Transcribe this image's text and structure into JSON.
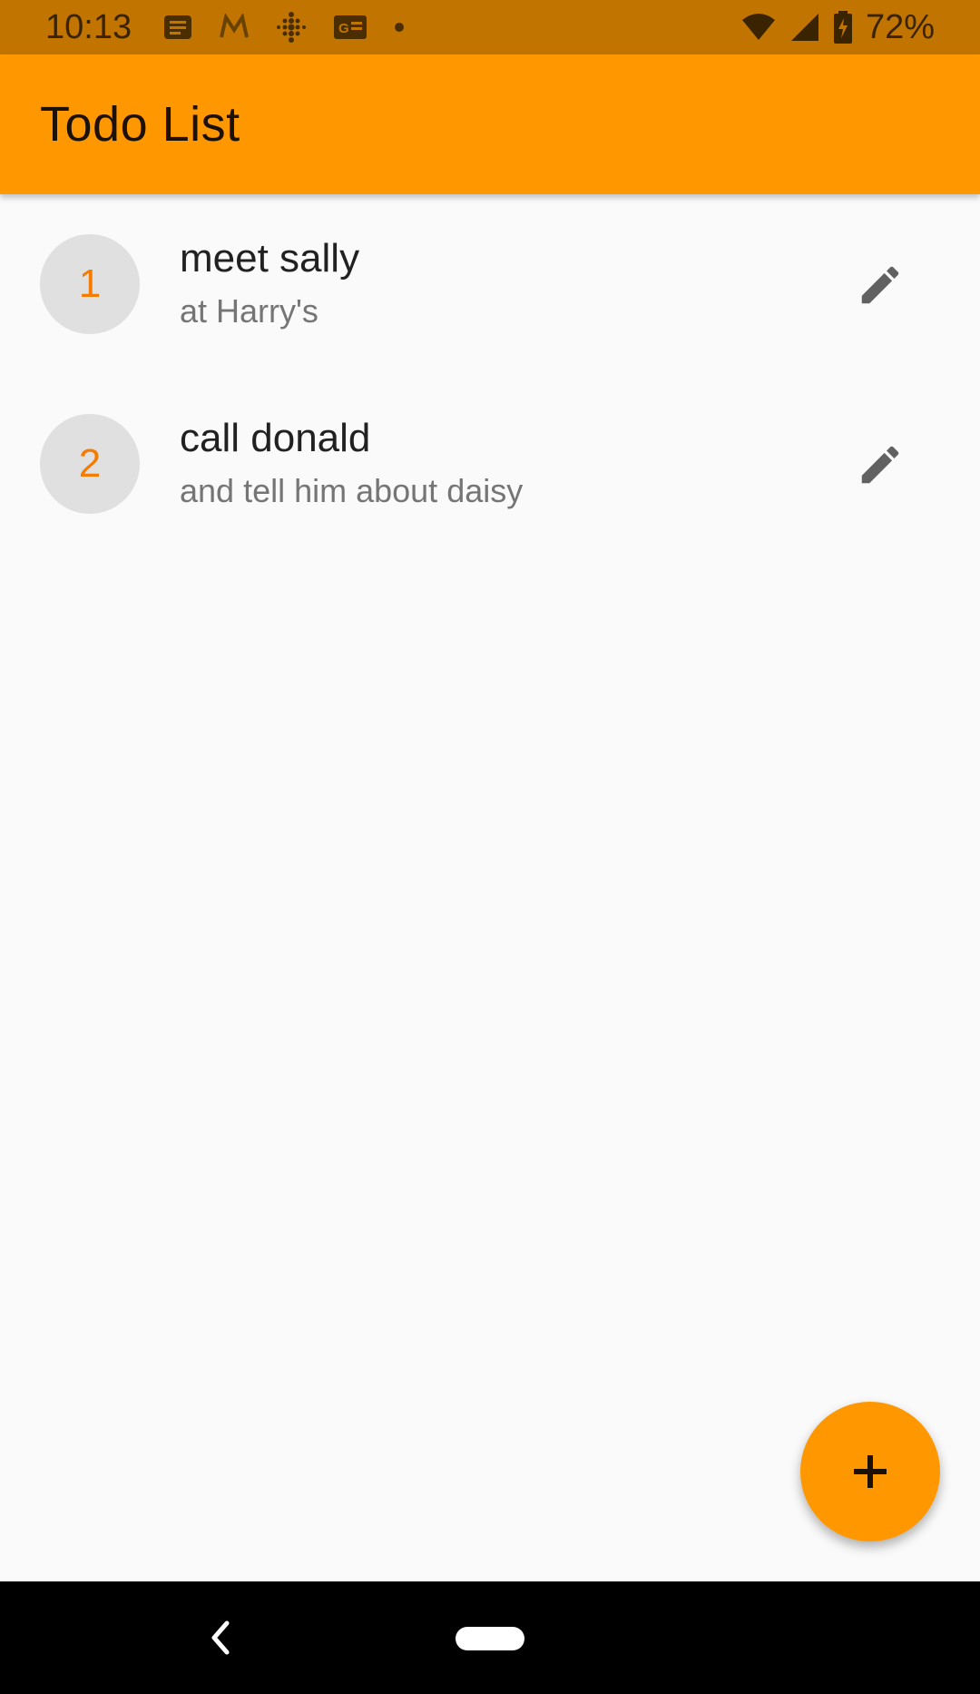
{
  "status_bar": {
    "time": "10:13",
    "battery_percent": "72%",
    "left_icons": [
      "notes-icon",
      "gmail-icon",
      "fitbit-icon",
      "news-icon",
      "dot-icon"
    ],
    "right_icons": [
      "wifi-icon",
      "signal-icon",
      "battery-charging-icon"
    ]
  },
  "app_bar": {
    "title": "Todo List",
    "color": "#ff9800"
  },
  "todos": [
    {
      "number": "1",
      "title": "meet sally",
      "subtitle": "at Harry's",
      "action_icon": "edit-icon"
    },
    {
      "number": "2",
      "title": "call donald",
      "subtitle": "and tell him about daisy",
      "action_icon": "edit-icon"
    }
  ],
  "fab": {
    "icon": "plus-icon",
    "color": "#ff9800"
  },
  "nav_bar": {
    "back_icon": "back-icon",
    "home_icon": "home-pill-icon"
  }
}
